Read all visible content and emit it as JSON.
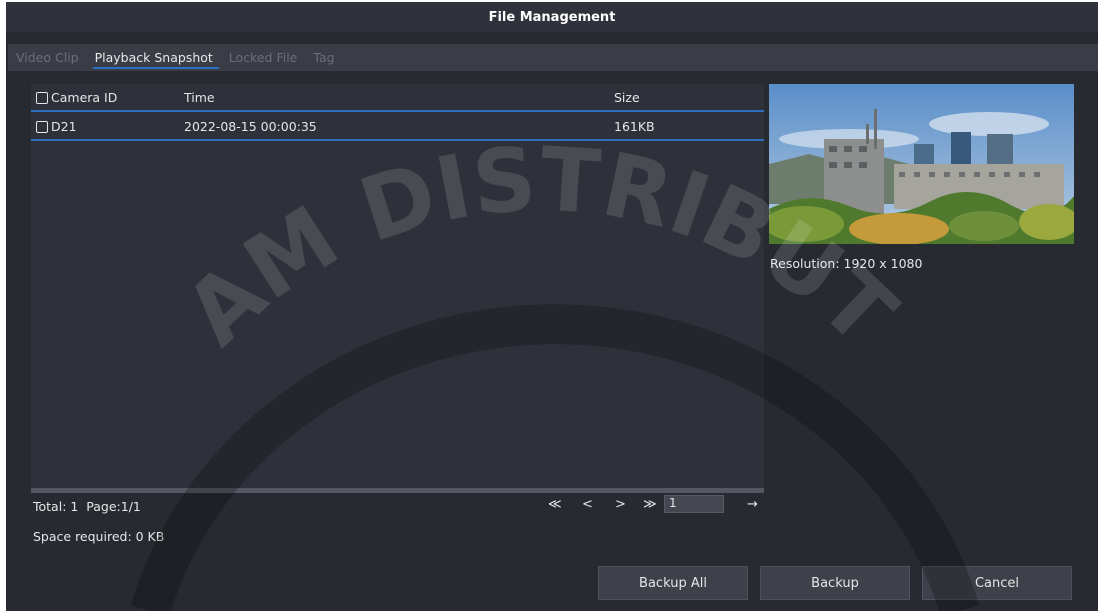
{
  "window": {
    "title": "File Management"
  },
  "tabs": [
    {
      "label": "Video Clip",
      "active": false
    },
    {
      "label": "Playback Snapshot",
      "active": true
    },
    {
      "label": "Locked File",
      "active": false
    },
    {
      "label": "Tag",
      "active": false
    }
  ],
  "table": {
    "headers": {
      "camera_id": "Camera ID",
      "time": "Time",
      "size": "Size"
    },
    "rows": [
      {
        "camera_id": "D21",
        "time": "2022-08-15 00:00:35",
        "size": "161KB",
        "checked": false
      }
    ]
  },
  "preview": {
    "resolution": "Resolution: 1920 x 1080"
  },
  "footer": {
    "total": "Total: 1",
    "page": "Page:1/1",
    "space_required": "Space required: 0 KB",
    "page_input": "1"
  },
  "pager_icons": [
    "first-page-icon",
    "prev-page-icon",
    "next-page-icon",
    "last-page-icon",
    "go-icon"
  ],
  "pager_glyphs": {
    "first": "≪",
    "prev": "<",
    "next": ">",
    "last": "≫",
    "go": "→"
  },
  "buttons": {
    "backup_all": "Backup All",
    "backup": "Backup",
    "cancel": "Cancel"
  },
  "watermark": {
    "text": "AM DISTRIBUT"
  },
  "colors": {
    "accent": "#2f6fbf",
    "background": "#272a31",
    "panel": "#2e3139"
  }
}
